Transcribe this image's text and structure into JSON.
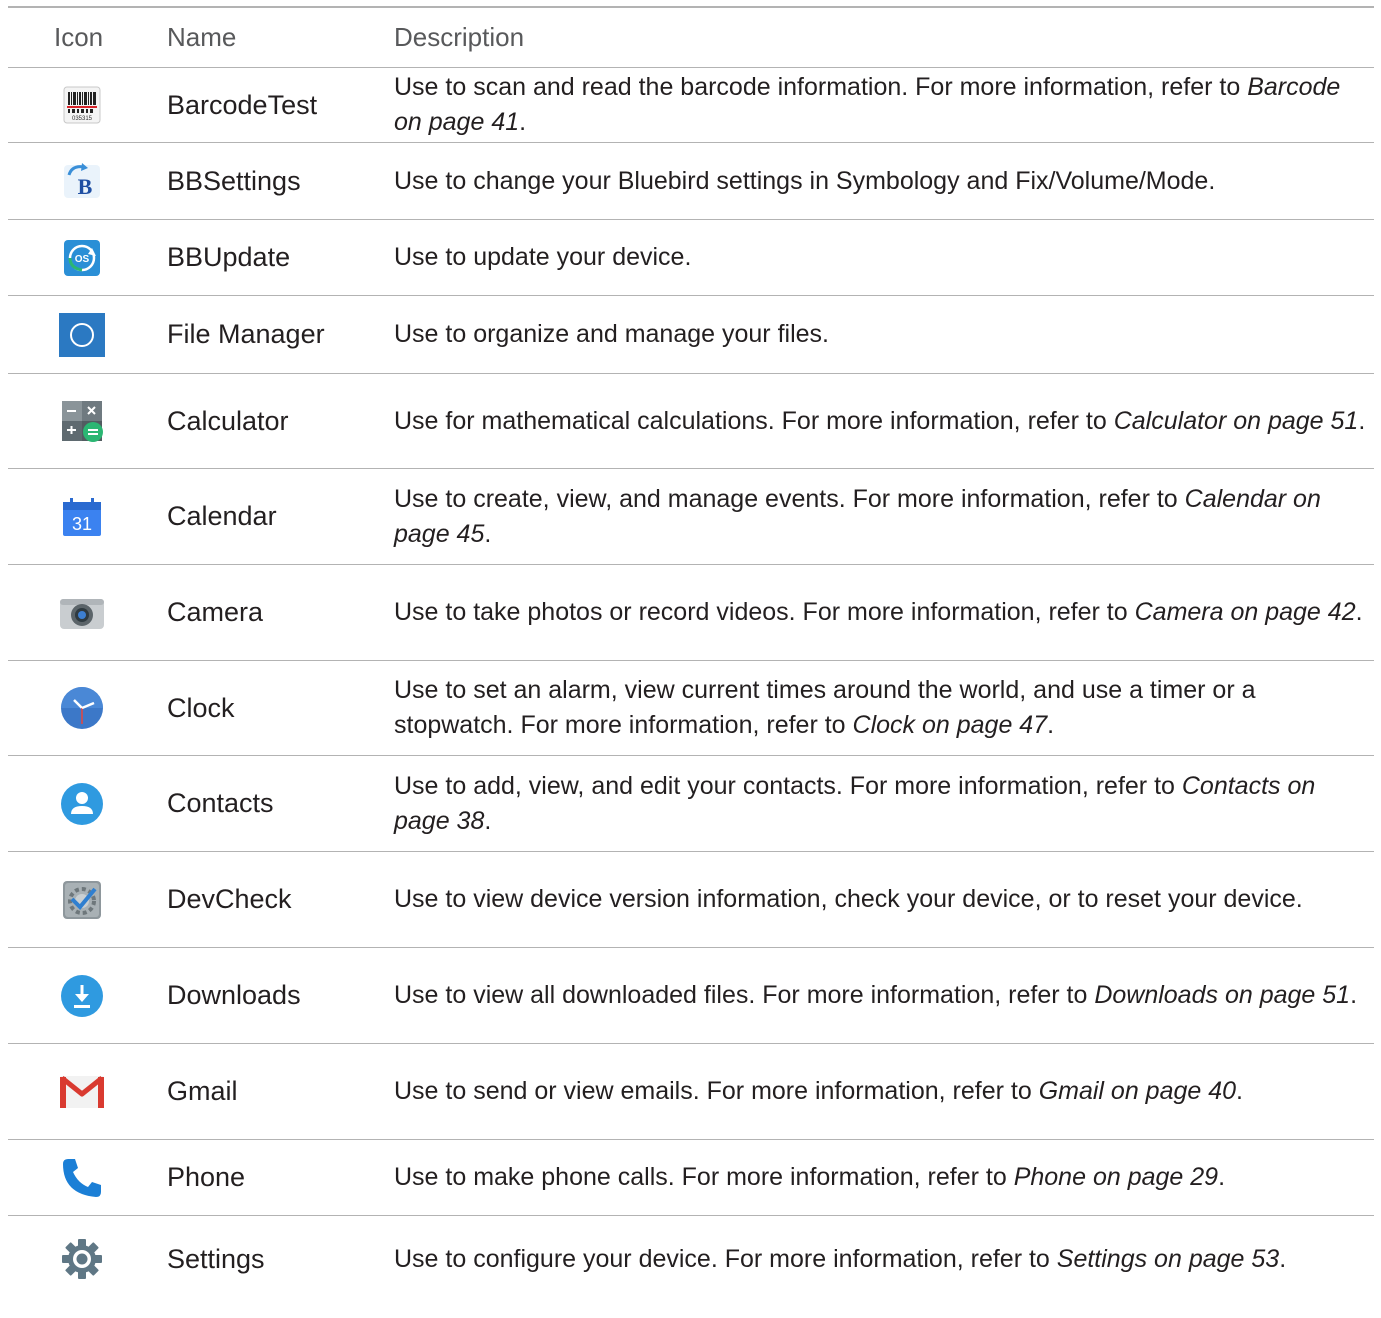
{
  "header": {
    "icon": "Icon",
    "name": "Name",
    "description": "Description"
  },
  "rows": [
    {
      "icon": "barcode-icon",
      "name": "BarcodeTest",
      "desc": "Use to scan and read the barcode information. For more information, refer to ",
      "link": "Barcode on page 41",
      "end": "."
    },
    {
      "icon": "bbsettings-icon",
      "name": "BBSettings",
      "desc": "Use to change your Bluebird settings in Symbology and Fix/Volume/Mode.",
      "link": "",
      "end": ""
    },
    {
      "icon": "bbupdate-icon",
      "name": "BBUpdate",
      "desc": "Use to update your device.",
      "link": "",
      "end": ""
    },
    {
      "icon": "file-manager-icon",
      "name": "File Manager",
      "desc": "Use to organize and manage your files.",
      "link": "",
      "end": ""
    },
    {
      "icon": "calculator-icon",
      "name": "Calculator",
      "desc": "Use for mathematical calculations. For more information, refer to ",
      "link": "Calculator on page 51",
      "end": "."
    },
    {
      "icon": "calendar-icon",
      "name": "Calendar",
      "desc": "Use to create, view, and manage events. For more information, refer to ",
      "link": "Calendar on page 45",
      "end": "."
    },
    {
      "icon": "camera-icon",
      "name": "Camera",
      "desc": "Use to take photos or record videos. For more information, refer to ",
      "link": "Camera on page 42",
      "end": "."
    },
    {
      "icon": "clock-icon",
      "name": "Clock",
      "desc": "Use to set an alarm, view current times around the world, and use a timer or a stopwatch. For more information, refer to ",
      "link": "Clock on page 47",
      "end": "."
    },
    {
      "icon": "contacts-icon",
      "name": "Contacts",
      "desc": "Use to add, view, and edit your contacts. For more information, refer to ",
      "link": "Contacts on page 38",
      "end": "."
    },
    {
      "icon": "devcheck-icon",
      "name": "DevCheck",
      "desc": "Use to view device version information, check your device, or to reset your device.",
      "link": "",
      "end": ""
    },
    {
      "icon": "downloads-icon",
      "name": "Downloads",
      "desc": "Use to view all downloaded files. For more information, refer to ",
      "link": "Downloads on page 51",
      "end": "."
    },
    {
      "icon": "gmail-icon",
      "name": "Gmail",
      "desc": "Use to send or view emails. For more information, refer to ",
      "link": "Gmail on page 40",
      "end": "."
    },
    {
      "icon": "phone-icon",
      "name": "Phone",
      "desc": "Use to make phone calls. For more information, refer to ",
      "link": "Phone on page 29",
      "end": "."
    },
    {
      "icon": "settings-icon",
      "name": "Settings",
      "desc": "Use to configure your device. For more information, refer to ",
      "link": "Settings on page 53",
      "end": "."
    }
  ],
  "icon_text": {
    "barcode_digits": "035315",
    "bbsettings_letter": "B",
    "bbupdate_label": "OS",
    "calendar_day": "31"
  },
  "colors": {
    "rule": "#b3b3b3",
    "header_text": "#58595b",
    "body_text": "#231f20",
    "blue": "#2b79c2",
    "accent_green": "#2bb673"
  }
}
